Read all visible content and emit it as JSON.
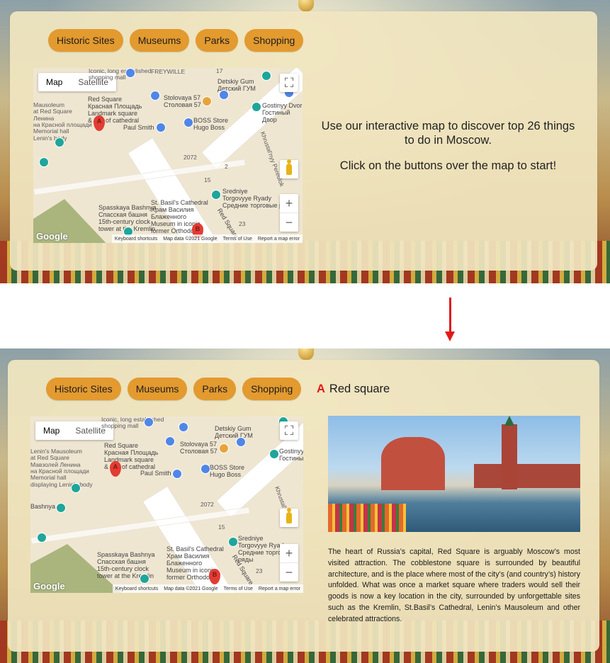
{
  "categories": [
    "Historic Sites",
    "Museums",
    "Parks",
    "Shopping"
  ],
  "map": {
    "type_map": "Map",
    "type_satellite": "Satellite",
    "zoom_in": "+",
    "zoom_out": "−",
    "google": "Google",
    "footer": [
      "Keyboard shortcuts",
      "Map data ©2021 Google",
      "Terms of Use",
      "Report a map error"
    ],
    "labels_top": {
      "l1": "Iconic, long established\nshopping mall",
      "l2": "FREYWILLE",
      "l3": "Detskiy Gum\nДетский ГУМ",
      "l4": "Stolovaya 57\nСтоловая 57",
      "l5": "Gostinyy Dvor\nГостиный Двор",
      "l6": "Red Square\nКрасная Площадь\nLandmark square\n& site of cathedral",
      "l7": "Mausoleum\nat Red Square\nЛенина\nна Красной площади\nMemorial hall\nLenin's body",
      "l8": "Paul Smith",
      "l9": "BOSS Store\nHugo Boss",
      "l10": "Khrustal'nyy Pereulok",
      "l11": "Sredniye\nTorgovyye Ryady\nСредние торговые ряды",
      "l12": "Spasskaya Bashnya\nСпасская башня\n15th-century clock\ntower at the Kremlin",
      "l13": "St. Basil's Cathedral\nХрам Василия\nБлаженного\nMuseum in iconic\nformer Orthodox...",
      "l14": "Red Square",
      "l15": "2072",
      "l16": "15",
      "l17": "23",
      "l18": "17",
      "l19": "2"
    },
    "labels_bottom": {
      "l1": "Iconic, long established\nshopping mall",
      "l3": "Detskiy Gum\nДетский ГУМ",
      "l4": "Stolovaya 57\nСтоловая 57",
      "l5": "Gostinyy\nГостины",
      "l6": "Red Square\nКрасная Площадь\nLandmark square\n& site of cathedral",
      "l7": "Lenin's Mausoleum\nat Red Square\nМавзолей Ленина\nна Красной площади\nMemorial hall\ndisplaying Lenin's body",
      "l8": "Paul Smith",
      "l9": "BOSS Store\nHugo Boss",
      "l10": "Khrustal'nyy",
      "l11": "Sredniye\nTorgovyye Ryady\nСредние торговые ряды",
      "l12": "Spasskaya Bashnya\nСпасская башня\n15th-century clock\ntower at the Kremlin",
      "l13": "St. Basil's Cathedral\nХрам Василия\nБлаженного\nMuseum in iconic\nformer Orthodox...",
      "l14": "Red Square",
      "l15": "2072",
      "l16": "15",
      "l17": "23",
      "l20": "Bashnya"
    },
    "marker_a": "A",
    "marker_b": "B"
  },
  "intro": {
    "line1": "Use our interactive map to discover top 26 things to do in Moscow.",
    "line2": "Click on the buttons over the map to start!"
  },
  "detail": {
    "letter": "A",
    "title": "Red square",
    "description": "The heart of Russia’s capital, Red Square is arguably Moscow’s most visited attraction. The cobblestone square is surrounded by beautiful architecture, and is the place where most of the city’s (and country’s) history unfolded. What was once a market square where traders would sell their goods is now a key location in the city, surrounded by unforgettable sites such as the Kremlin, St.Basil’s Cathedral, Lenin’s Mausoleum and other celebrated attractions."
  },
  "colors": {
    "accent": "#e39a2f",
    "arrow": "#e21919",
    "panel": "#f0e5c0"
  }
}
